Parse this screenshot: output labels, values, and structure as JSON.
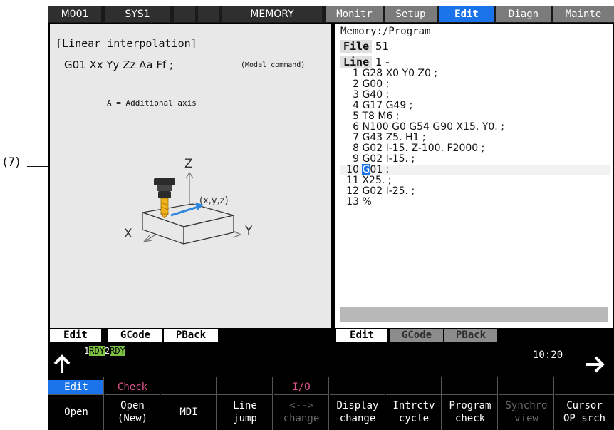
{
  "annotation": {
    "label": "(7)"
  },
  "topbar": {
    "machine": "M001",
    "system": "SYS1",
    "mode": "MEMORY",
    "menus": [
      {
        "label": "Monitr",
        "active": false
      },
      {
        "label": "Setup",
        "active": false
      },
      {
        "label": "Edit",
        "active": true
      },
      {
        "label": "Diagn",
        "active": false
      },
      {
        "label": "Mainte",
        "active": false
      }
    ]
  },
  "guide": {
    "title": "[Linear interpolation]",
    "format": "G01 Xx Yy Zz Aa Ff ;",
    "note": "(Modal command)",
    "axis_note": "A = Additional axis",
    "axis_z": "Z",
    "axis_x": "X",
    "axis_y": "Y",
    "point": "(x,y,z)"
  },
  "program": {
    "path": "Memory:/Program",
    "file_label": "File",
    "file_value": "51",
    "line_label": "Line",
    "line_value": "1 -",
    "lines": [
      {
        "num": "1",
        "text": "G28 X0 Y0 Z0 ;"
      },
      {
        "num": "2",
        "text": "G00 ;"
      },
      {
        "num": "3",
        "text": "G40 ;"
      },
      {
        "num": "4",
        "text": "G17 G49 ;"
      },
      {
        "num": "5",
        "text": "T8 M6 ;"
      },
      {
        "num": "6",
        "text": "N100 G0 G54 G90 X15. Y0. ;"
      },
      {
        "num": "7",
        "text": "G43 Z5. H1 ;"
      },
      {
        "num": "8",
        "text": "G02 I-15. Z-100. F2000 ;"
      },
      {
        "num": "9",
        "text": "G02 I-15. ;"
      },
      {
        "num": "10",
        "text_cursor": "G",
        "text_rest": "01 ;"
      },
      {
        "num": "11",
        "text": "X25. ;"
      },
      {
        "num": "12",
        "text": "G02 I-25. ;"
      },
      {
        "num": "13",
        "text": "%"
      }
    ]
  },
  "left_tabs": [
    "Edit",
    "GCode",
    "PBack"
  ],
  "right_tabs": [
    "Edit",
    "GCode",
    "PBack"
  ],
  "status": {
    "rdy1_num": "1",
    "rdy1": "RDY",
    "rdy2_num": "2",
    "rdy2": "RDY",
    "time": "10:20"
  },
  "softkeys": [
    {
      "top": "Edit",
      "bottom": [
        "Open"
      ],
      "top_color": "#1a73e8",
      "top_bg": true
    },
    {
      "top": "Check",
      "bottom": [
        "Open",
        "(New)"
      ],
      "top_color": "#e3568f"
    },
    {
      "top": "",
      "bottom": [
        "MDI"
      ]
    },
    {
      "top": "",
      "bottom": [
        "Line",
        "jump"
      ]
    },
    {
      "top": "I/O",
      "bottom": [
        "<-->",
        "change"
      ],
      "top_color": "#e3568f",
      "dim": true
    },
    {
      "top": "",
      "bottom": [
        "Display",
        "change"
      ]
    },
    {
      "top": "",
      "bottom": [
        "Intrctv",
        "cycle"
      ]
    },
    {
      "top": "",
      "bottom": [
        "Program",
        "check"
      ]
    },
    {
      "top": "",
      "bottom": [
        "Synchro",
        "view"
      ],
      "dim": true
    },
    {
      "top": "",
      "bottom": [
        "Cursor",
        "OP srch"
      ]
    }
  ],
  "colors": {
    "accent": "#1a73e8",
    "ready": "#7cc242",
    "check": "#e3568f",
    "tool_tip": "#f2b21c"
  }
}
